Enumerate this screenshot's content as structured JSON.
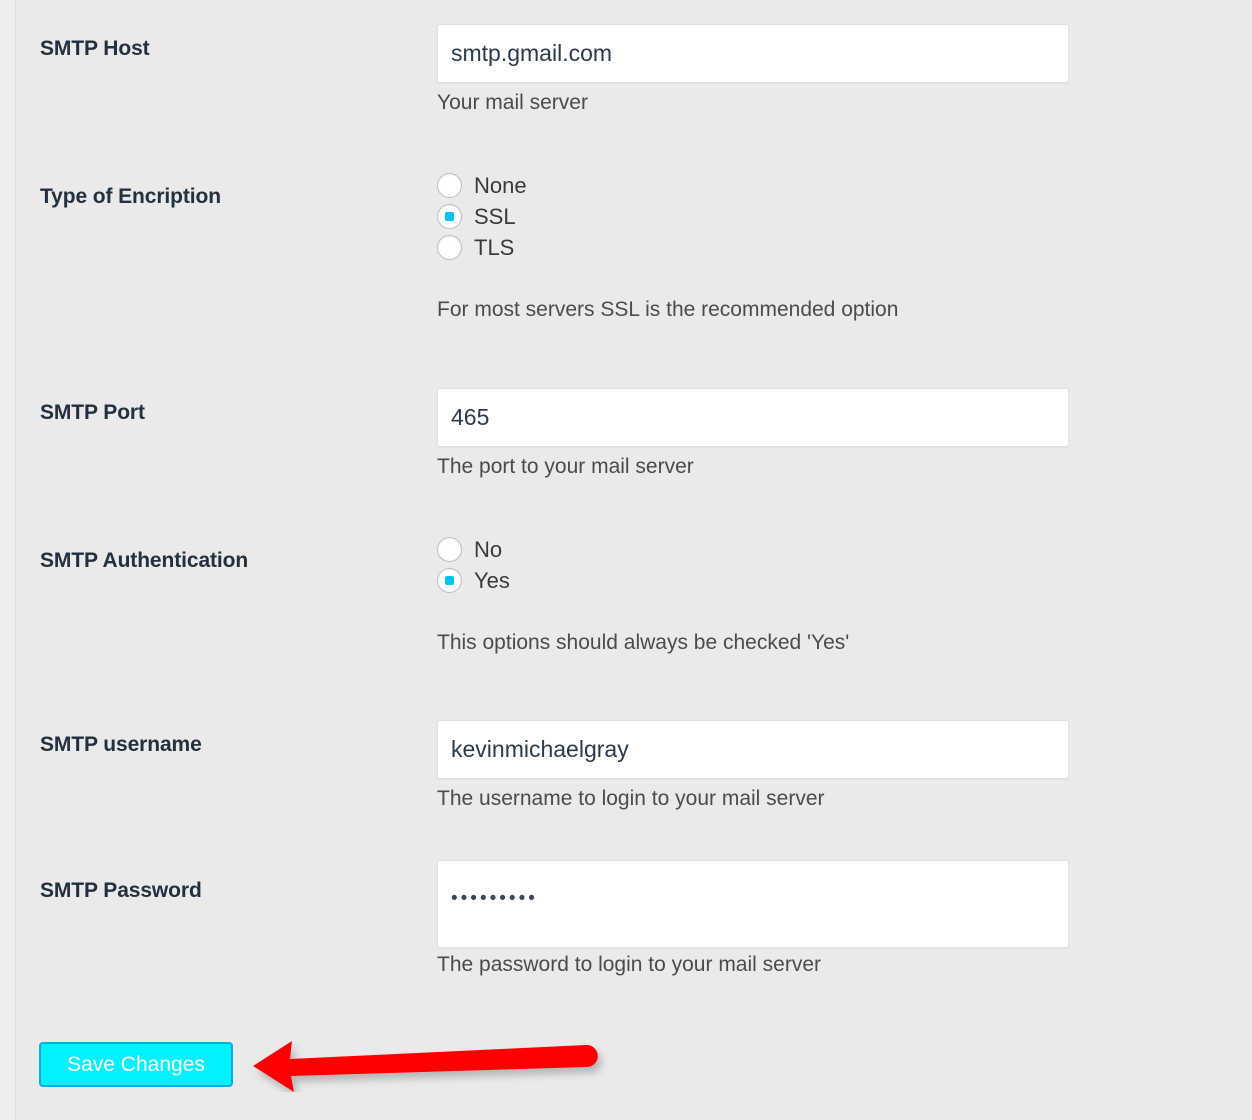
{
  "theme": {
    "page_background": "#eaeaea",
    "accent_cyan": "#00f2fe",
    "radio_checked": "#00c3f5",
    "label_color": "#22303f",
    "help_color": "#4b4b4b",
    "annotation_arrow": "#ff0000"
  },
  "form": {
    "fields": [
      {
        "key": "smtp_host",
        "label": "SMTP Host",
        "type": "text",
        "value": "smtp.gmail.com",
        "placeholder": "smtp.gmail.com",
        "help": "Your mail server"
      },
      {
        "key": "encryption_type",
        "label": "Type of Encription",
        "type": "radio",
        "options": [
          {
            "label": "None",
            "value": "none",
            "checked": false
          },
          {
            "label": "SSL",
            "value": "ssl",
            "checked": true
          },
          {
            "label": "TLS",
            "value": "tls",
            "checked": false
          }
        ],
        "selected": "SSL",
        "help": "For most servers SSL is the recommended option"
      },
      {
        "key": "smtp_port",
        "label": "SMTP Port",
        "type": "text",
        "value": "465",
        "placeholder": "465",
        "help": "The port to your mail server"
      },
      {
        "key": "smtp_authentication",
        "label": "SMTP Authentication",
        "type": "radio",
        "options": [
          {
            "label": "No",
            "value": "no",
            "checked": false
          },
          {
            "label": "Yes",
            "value": "yes",
            "checked": true
          }
        ],
        "selected": "Yes",
        "help": "This options should always be checked 'Yes'"
      },
      {
        "key": "smtp_username",
        "label": "SMTP username",
        "type": "text",
        "value": "kevinmichaelgray",
        "placeholder": "kevinmichaelgray",
        "help": "The username to login to your mail server"
      },
      {
        "key": "smtp_password",
        "label": "SMTP Password",
        "type": "password",
        "value": "•••••••••",
        "masked_char_count": 9,
        "help": "The password to login to your mail server"
      }
    ]
  },
  "actions": {
    "save_label": "Save Changes"
  },
  "annotations": {
    "arrow": {
      "icon": "arrow-left-icon",
      "color": "#ff0000",
      "points_to": "Save Changes"
    }
  }
}
